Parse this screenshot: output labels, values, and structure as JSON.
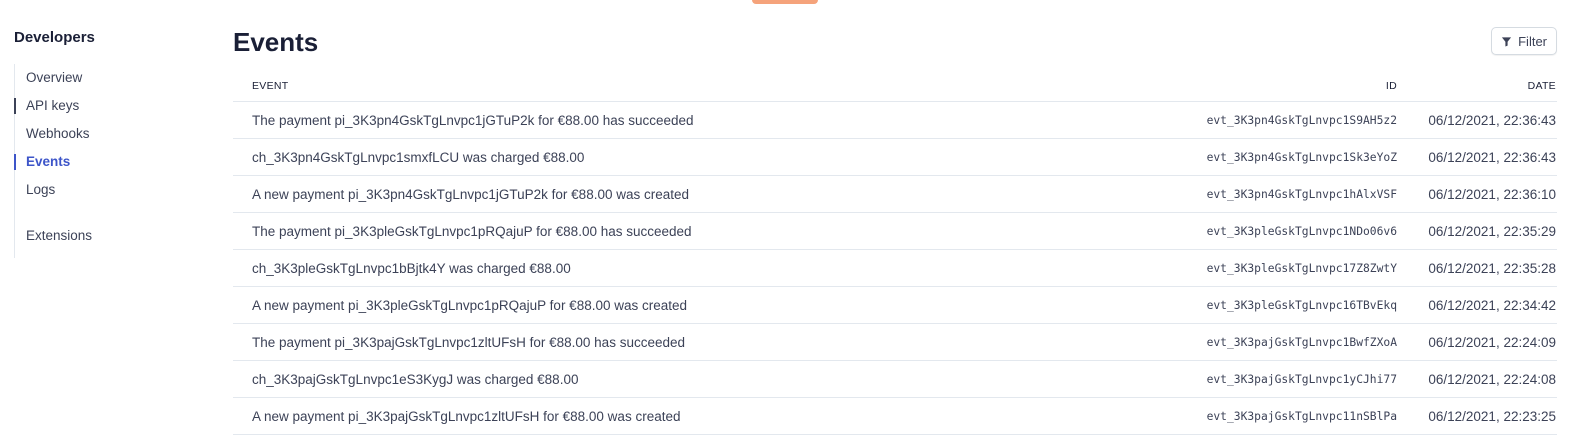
{
  "sidebar": {
    "title": "Developers",
    "items": [
      {
        "label": "Overview"
      },
      {
        "label": "API keys"
      },
      {
        "label": "Webhooks"
      },
      {
        "label": "Events"
      },
      {
        "label": "Logs"
      }
    ],
    "extensions_label": "Extensions"
  },
  "header": {
    "title": "Events",
    "filter_label": "Filter"
  },
  "table": {
    "columns": {
      "event": "EVENT",
      "id": "ID",
      "date": "DATE"
    },
    "rows": [
      {
        "event": "The payment pi_3K3pn4GskTgLnvpc1jGTuP2k for €88.00 has succeeded",
        "id": "evt_3K3pn4GskTgLnvpc1S9AH5z2",
        "date": "06/12/2021, 22:36:43"
      },
      {
        "event": "ch_3K3pn4GskTgLnvpc1smxfLCU was charged €88.00",
        "id": "evt_3K3pn4GskTgLnvpc1Sk3eYoZ",
        "date": "06/12/2021, 22:36:43"
      },
      {
        "event": "A new payment pi_3K3pn4GskTgLnvpc1jGTuP2k for €88.00 was created",
        "id": "evt_3K3pn4GskTgLnvpc1hAlxVSF",
        "date": "06/12/2021, 22:36:10"
      },
      {
        "event": "The payment pi_3K3pleGskTgLnvpc1pRQajuP for €88.00 has succeeded",
        "id": "evt_3K3pleGskTgLnvpc1NDo06v6",
        "date": "06/12/2021, 22:35:29"
      },
      {
        "event": "ch_3K3pleGskTgLnvpc1bBjtk4Y was charged €88.00",
        "id": "evt_3K3pleGskTgLnvpc17Z8ZwtY",
        "date": "06/12/2021, 22:35:28"
      },
      {
        "event": "A new payment pi_3K3pleGskTgLnvpc1pRQajuP for €88.00 was created",
        "id": "evt_3K3pleGskTgLnvpc16TBvEkq",
        "date": "06/12/2021, 22:34:42"
      },
      {
        "event": "The payment pi_3K3pajGskTgLnvpc1zltUFsH for €88.00 has succeeded",
        "id": "evt_3K3pajGskTgLnvpc1BwfZXoA",
        "date": "06/12/2021, 22:24:09"
      },
      {
        "event": "ch_3K3pajGskTgLnvpc1eS3KygJ was charged €88.00",
        "id": "evt_3K3pajGskTgLnvpc1yCJhi77",
        "date": "06/12/2021, 22:24:08"
      },
      {
        "event": "A new payment pi_3K3pajGskTgLnvpc1zltUFsH for €88.00 was created",
        "id": "evt_3K3pajGskTgLnvpc11nSBlPa",
        "date": "06/12/2021, 22:23:25"
      }
    ]
  },
  "colors": {
    "accent": "#3d55c9",
    "top_tab": "#f5a37b",
    "title": "#1a1f36",
    "text": "#3c4257",
    "border": "#e3e8ee"
  },
  "icons": {
    "filter": "filter-funnel-icon"
  }
}
